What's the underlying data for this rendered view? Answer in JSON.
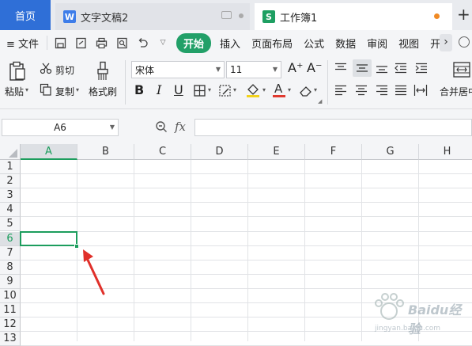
{
  "tabs": {
    "home": "首页",
    "doc_icon": "W",
    "doc": "文字文稿2",
    "sheet_icon": "S",
    "sheet": "工作簿1",
    "add": "+"
  },
  "menu": {
    "file": "≡ 文件",
    "items": [
      "开始",
      "插入",
      "页面布局",
      "公式",
      "数据",
      "审阅",
      "视图",
      "开发"
    ],
    "more": "›"
  },
  "ribbon": {
    "paste": "粘贴",
    "cut": "剪切",
    "copy": "复制",
    "format_painter": "格式刷",
    "font_name": "宋体",
    "font_size": "11",
    "grow_font": "A⁺",
    "shrink_font": "A⁻",
    "bold": "B",
    "italic": "I",
    "underline": "U",
    "font_color_glyph": "A",
    "merge_center": "合并居中",
    "accent_font_color": "#e03a2f",
    "accent_fill": "#f2d21c"
  },
  "formula": {
    "cell_ref": "A6",
    "fx": "fx",
    "value": ""
  },
  "grid": {
    "columns": [
      "A",
      "B",
      "C",
      "D",
      "E",
      "F",
      "G",
      "H"
    ],
    "rows": [
      "1",
      "2",
      "3",
      "4",
      "5",
      "6",
      "7",
      "8",
      "9",
      "10",
      "11",
      "12",
      "13"
    ],
    "selected_cell": "A6",
    "accent": "#1c9d5d"
  },
  "watermark": {
    "brand": "Baidu经验",
    "url": "jingyan.baidu.com"
  }
}
